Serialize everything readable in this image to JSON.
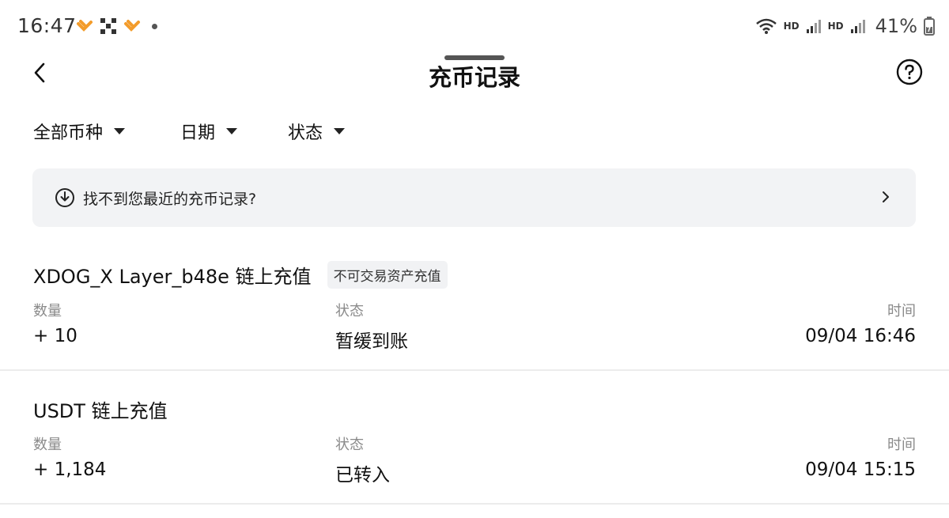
{
  "status_bar": {
    "time": "16:47",
    "network_hd_1": "HD",
    "network_hd_2": "HD",
    "battery": "41%"
  },
  "header": {
    "title": "充币记录"
  },
  "filters": [
    {
      "label": "全部币种"
    },
    {
      "label": "日期"
    },
    {
      "label": "状态"
    }
  ],
  "notice": {
    "text": "找不到您最近的充币记录?"
  },
  "records": [
    {
      "title": "XDOG_X Layer_b48e 链上充值",
      "badge": "不可交易资产充值",
      "qty_label": "数量",
      "qty_value": "+ 10",
      "status_label": "状态",
      "status_value": "暂缓到账",
      "time_label": "时间",
      "time_value": "09/04 16:46"
    },
    {
      "title": "USDT 链上充值",
      "badge": "",
      "qty_label": "数量",
      "qty_value": "+ 1,184",
      "status_label": "状态",
      "status_value": "已转入",
      "time_label": "时间",
      "time_value": "09/04 15:15"
    }
  ],
  "colors": {
    "accent_app_icon": "#f39c2b",
    "banner_bg": "#f2f3f5",
    "muted_text": "#8a8a8a"
  }
}
